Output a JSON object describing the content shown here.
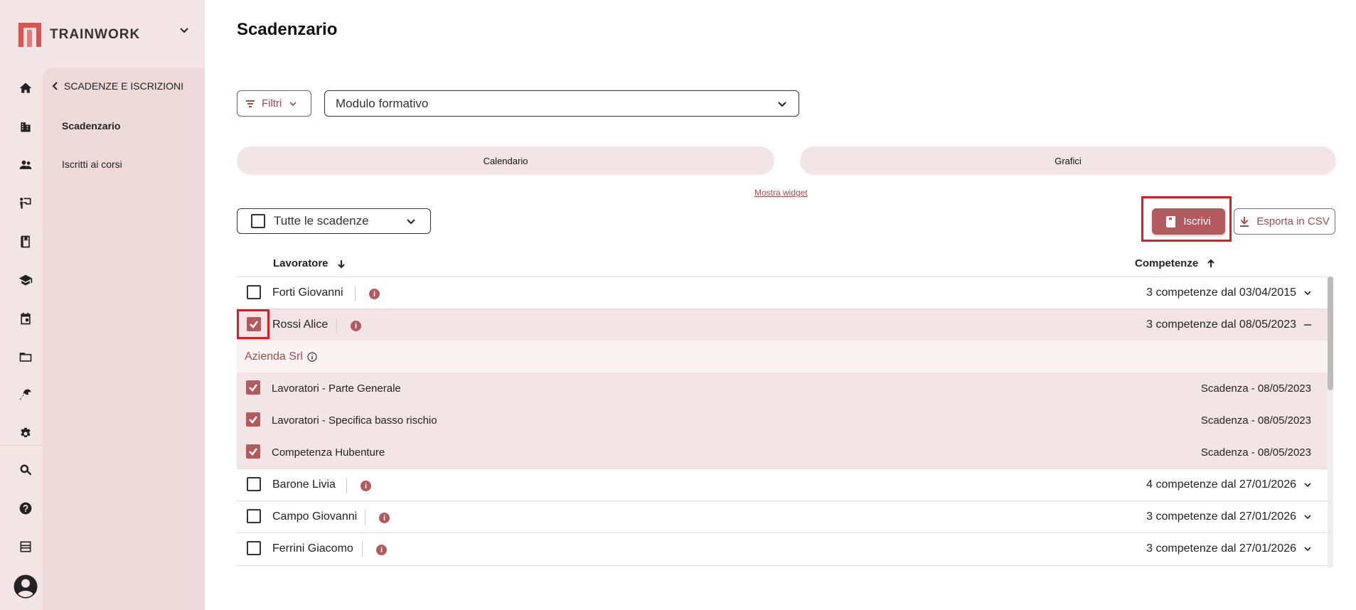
{
  "brand": {
    "name": "TRAINWORK"
  },
  "sidebar": {
    "back_label": "SCADENZE E ISCRIZIONI",
    "items": [
      {
        "label": "Scadenzario"
      },
      {
        "label": "Iscritti ai corsi"
      }
    ]
  },
  "nav_icons": [
    "home-icon",
    "buildings-icon",
    "people-icon",
    "presentation-icon",
    "book-icon",
    "graduation-icon",
    "calendar-icon",
    "folder-icon",
    "wrench-icon",
    "gear-icon",
    "search-icon",
    "help-icon",
    "inbox-icon",
    "account-icon"
  ],
  "page": {
    "title": "Scadenzario"
  },
  "filters": {
    "filter_label": "Filtri",
    "module_value": "Modulo formativo"
  },
  "tabs": [
    {
      "label": "Calendario"
    },
    {
      "label": "Grafici"
    }
  ],
  "widget_link": "Mostra widget",
  "bulk_select": {
    "label": "Tutte le scadenze"
  },
  "actions": {
    "enroll_label": "Iscrivi",
    "export_label": "Esporta in CSV"
  },
  "table": {
    "col_worker": "Lavoratore",
    "col_skills": "Competenze",
    "rows": [
      {
        "name": "Forti Giovanni",
        "skills": "3 competenze dal 03/04/2015",
        "checked": false
      },
      {
        "name": "Rossi Alice",
        "skills": "3 competenze dal 08/05/2023",
        "checked": true,
        "expanded": true,
        "company": "Azienda Srl",
        "children": [
          {
            "name": "Lavoratori - Parte Generale",
            "deadline": "Scadenza - 08/05/2023"
          },
          {
            "name": "Lavoratori - Specifica basso rischio",
            "deadline": "Scadenza - 08/05/2023"
          },
          {
            "name": "Competenza Hubenture",
            "deadline": "Scadenza - 08/05/2023"
          }
        ]
      },
      {
        "name": "Barone Livia",
        "skills": "4 competenze dal 27/01/2026",
        "checked": false
      },
      {
        "name": "Campo Giovanni",
        "skills": "3 competenze dal 27/01/2026",
        "checked": false
      },
      {
        "name": "Ferrini Giacomo",
        "skills": "3 competenze dal 27/01/2026",
        "checked": false
      }
    ]
  },
  "colors": {
    "accent": "#b25a5e",
    "rail": "#f3e5e6",
    "highlight": "#e01b24"
  }
}
